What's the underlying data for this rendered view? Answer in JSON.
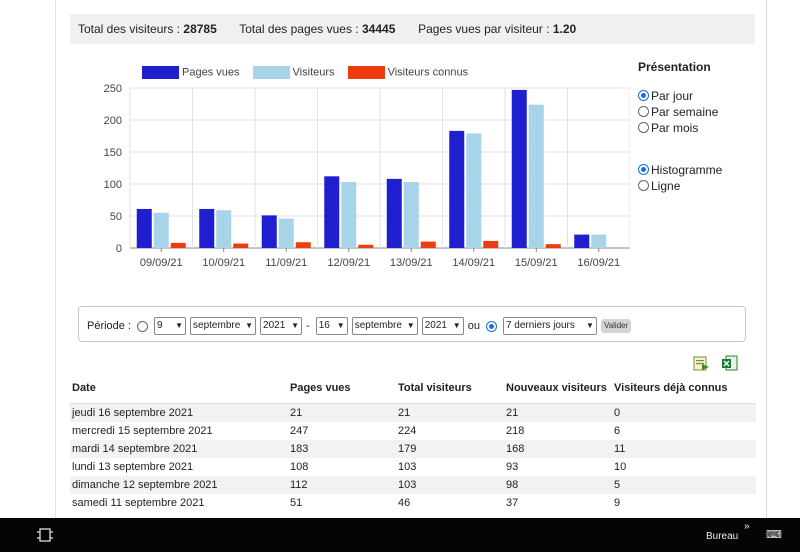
{
  "stats": {
    "total_visitors_label": "Total des visiteurs :",
    "total_visitors_value": "28785",
    "total_pages_label": "Total des pages vues :",
    "total_pages_value": "34445",
    "pages_per_visitor_label": "Pages vues par visiteur :",
    "pages_per_visitor_value": "1.20"
  },
  "chart_data": {
    "type": "bar",
    "categories": [
      "09/09/21",
      "10/09/21",
      "11/09/21",
      "12/09/21",
      "13/09/21",
      "14/09/21",
      "15/09/21",
      "16/09/21"
    ],
    "series": [
      {
        "name": "Pages vues",
        "values": [
          61,
          61,
          51,
          112,
          108,
          183,
          247,
          21
        ],
        "color": "#1f1fd0"
      },
      {
        "name": "Visiteurs",
        "values": [
          55,
          59,
          46,
          103,
          103,
          179,
          224,
          21
        ],
        "color": "#a8d4ea"
      },
      {
        "name": "Visiteurs connus",
        "values": [
          8,
          7,
          9,
          5,
          10,
          11,
          6,
          0
        ],
        "color": "#f03a10"
      }
    ],
    "ylim": [
      0,
      250
    ],
    "yticks": [
      0,
      50,
      100,
      150,
      200,
      250
    ],
    "grid": true,
    "legend": "top"
  },
  "presentation": {
    "title": "Présentation",
    "period_options": [
      {
        "label": "Par jour",
        "selected": true
      },
      {
        "label": "Par semaine",
        "selected": false
      },
      {
        "label": "Par mois",
        "selected": false
      }
    ],
    "chart_options": [
      {
        "label": "Histogramme",
        "selected": true
      },
      {
        "label": "Ligne",
        "selected": false
      }
    ]
  },
  "periode": {
    "label": "Période :",
    "from_day": "9",
    "from_month": "septembre",
    "from_year": "2021",
    "dash": "-",
    "to_day": "16",
    "to_month": "septembre",
    "to_year": "2021",
    "or_label": "ou",
    "preset": "7 derniers jours",
    "submit": "Valider"
  },
  "table": {
    "headers": [
      "Date",
      "Pages vues",
      "Total visiteurs",
      "Nouveaux visiteurs",
      "Visiteurs déjà connus"
    ],
    "rows": [
      [
        "jeudi 16 septembre 2021",
        "21",
        "21",
        "21",
        "0"
      ],
      [
        "mercredi 15 septembre 2021",
        "247",
        "224",
        "218",
        "6"
      ],
      [
        "mardi 14 septembre 2021",
        "183",
        "179",
        "168",
        "11"
      ],
      [
        "lundi 13 septembre 2021",
        "108",
        "103",
        "93",
        "10"
      ],
      [
        "dimanche 12 septembre 2021",
        "112",
        "103",
        "98",
        "5"
      ],
      [
        "samedi 11 septembre 2021",
        "51",
        "46",
        "37",
        "9"
      ]
    ]
  },
  "taskbar": {
    "bureau": "Bureau",
    "chevron": "»"
  }
}
